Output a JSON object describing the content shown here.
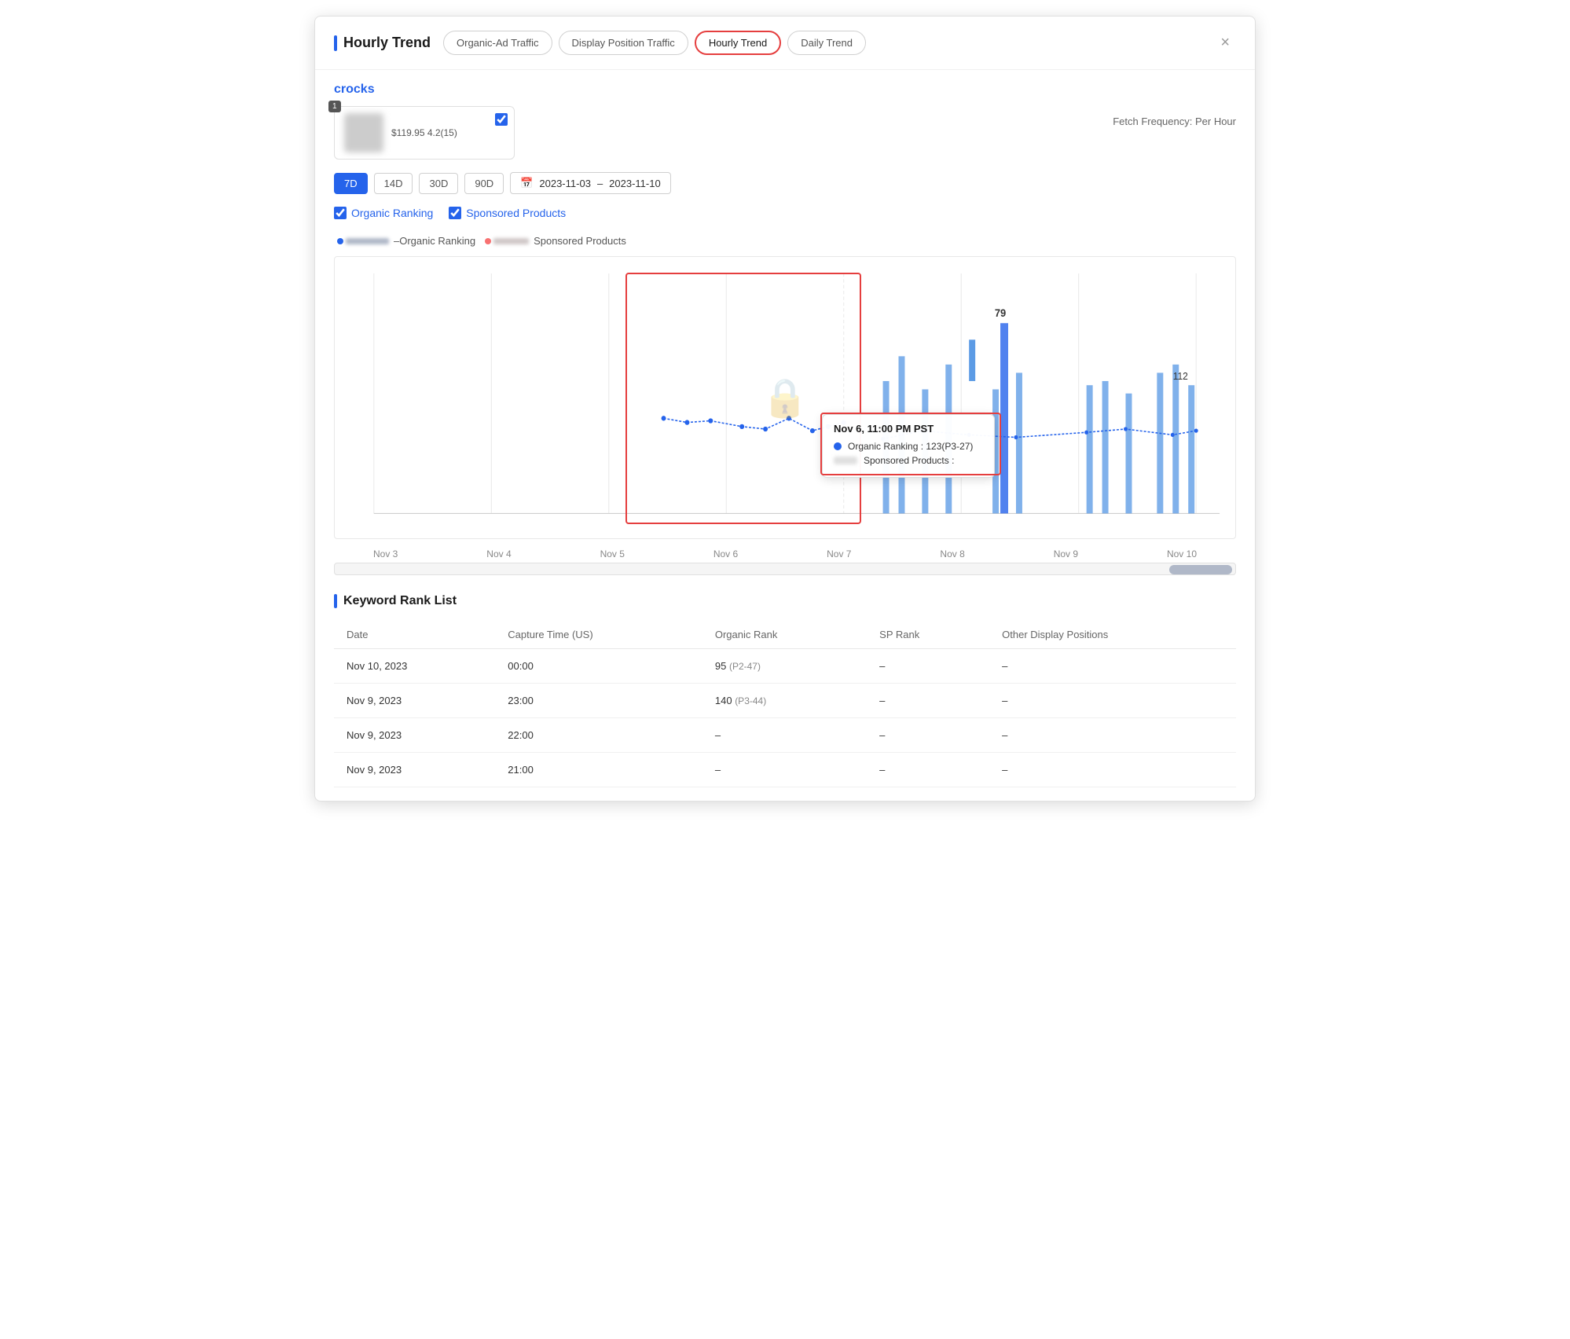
{
  "modal": {
    "title": "Hourly Trend",
    "close_label": "×",
    "tabs": [
      {
        "id": "organic-ad",
        "label": "Organic-Ad Traffic",
        "active": false
      },
      {
        "id": "display-position",
        "label": "Display Position Traffic",
        "active": false
      },
      {
        "id": "hourly-trend",
        "label": "Hourly Trend",
        "active": true
      },
      {
        "id": "daily-trend",
        "label": "Daily Trend",
        "active": false
      }
    ]
  },
  "product": {
    "brand": "crocks",
    "price_rating": "$119.95 4.2(15)",
    "fetch_frequency": "Fetch Frequency: Per Hour",
    "badge": "1"
  },
  "date_controls": {
    "periods": [
      {
        "label": "7D",
        "active": true
      },
      {
        "label": "14D",
        "active": false
      },
      {
        "label": "30D",
        "active": false
      },
      {
        "label": "90D",
        "active": false
      }
    ],
    "date_from": "2023-11-03",
    "date_to": "2023-11-10",
    "date_separator": "–"
  },
  "filters": [
    {
      "id": "organic-ranking",
      "label": "Organic Ranking",
      "checked": true
    },
    {
      "id": "sponsored-products",
      "label": "Sponsored Products",
      "checked": true
    }
  ],
  "chart": {
    "x_labels": [
      "Nov 3",
      "Nov 4",
      "Nov 5",
      "Nov 6",
      "Nov 7",
      "Nov 8",
      "Nov 9",
      "Nov 10"
    ],
    "value_label_79": "79",
    "value_label_112": "112",
    "tooltip": {
      "time": "Nov 6, 11:00 PM PST",
      "organic_ranking_label": "Organic Ranking : 123(P3-27)",
      "sponsored_products_label": "Sponsored Products :"
    }
  },
  "keyword_section": {
    "title": "Keyword Rank List",
    "columns": [
      "Date",
      "Capture Time (US)",
      "Organic Rank",
      "SP Rank",
      "Other Display Positions"
    ],
    "rows": [
      {
        "date": "Nov 10, 2023",
        "time": "00:00",
        "organic_rank": "95",
        "organic_rank_sub": "(P2-47)",
        "sp_rank": "–",
        "other": "–"
      },
      {
        "date": "Nov 9, 2023",
        "time": "23:00",
        "organic_rank": "140",
        "organic_rank_sub": "(P3-44)",
        "sp_rank": "–",
        "other": "–"
      },
      {
        "date": "Nov 9, 2023",
        "time": "22:00",
        "organic_rank": "–",
        "organic_rank_sub": "",
        "sp_rank": "–",
        "other": "–"
      },
      {
        "date": "Nov 9, 2023",
        "time": "21:00",
        "organic_rank": "–",
        "organic_rank_sub": "",
        "sp_rank": "–",
        "other": "–"
      }
    ]
  }
}
